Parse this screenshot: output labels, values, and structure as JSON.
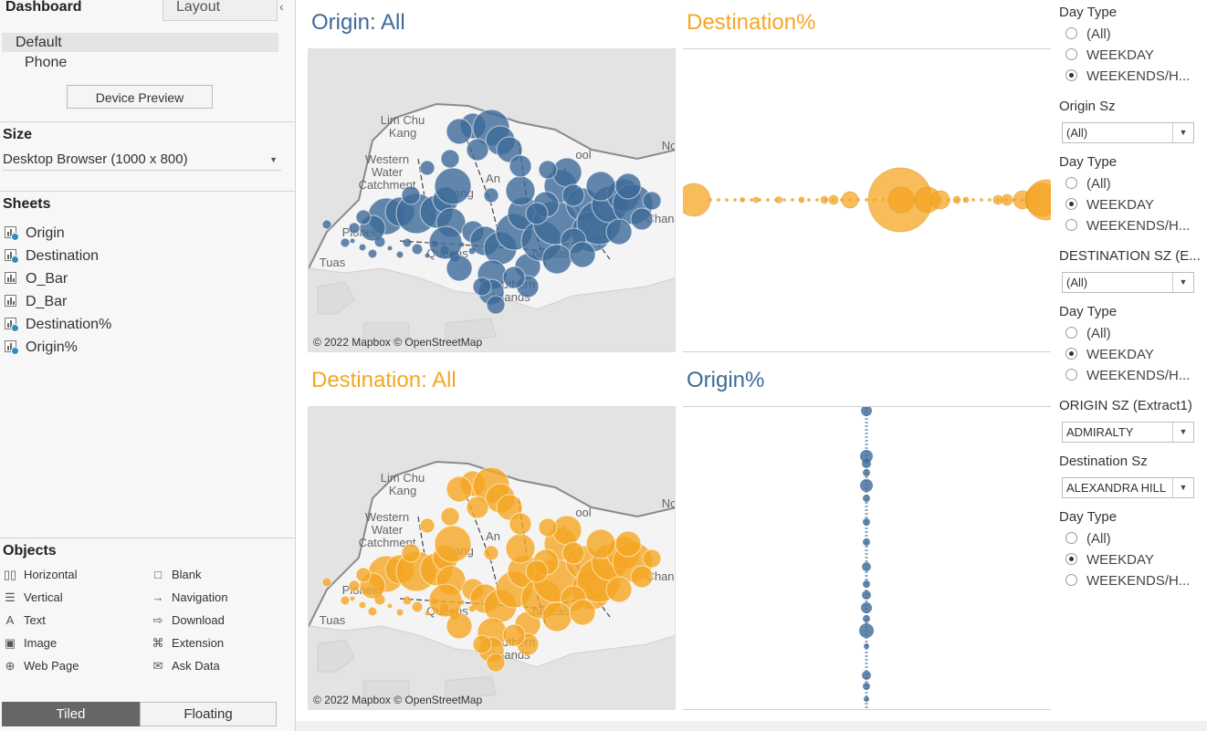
{
  "left_panel": {
    "tab_dashboard": "Dashboard",
    "tab_layout": "Layout",
    "collapse_icon": "chevron-left-icon",
    "device_default": "Default",
    "device_phone": "Phone",
    "device_preview_label": "Device Preview",
    "size_title": "Size",
    "size_value": "Desktop Browser (1000 x 800)",
    "sheets_title": "Sheets",
    "sheets": [
      {
        "label": "Origin",
        "in_use": true
      },
      {
        "label": "Destination",
        "in_use": true
      },
      {
        "label": "O_Bar",
        "in_use": false
      },
      {
        "label": "D_Bar",
        "in_use": false
      },
      {
        "label": "Destination%",
        "in_use": true
      },
      {
        "label": "Origin%",
        "in_use": true
      }
    ],
    "objects_title": "Objects",
    "objects": [
      {
        "label": "Horizontal",
        "icon": "horizontal-container-icon"
      },
      {
        "label": "Blank",
        "icon": "blank-icon"
      },
      {
        "label": "Vertical",
        "icon": "vertical-container-icon"
      },
      {
        "label": "Navigation",
        "icon": "navigation-icon"
      },
      {
        "label": "Text",
        "icon": "text-icon"
      },
      {
        "label": "Download",
        "icon": "download-icon"
      },
      {
        "label": "Image",
        "icon": "image-icon"
      },
      {
        "label": "Extension",
        "icon": "extension-icon"
      },
      {
        "label": "Web Page",
        "icon": "globe-icon"
      },
      {
        "label": "Ask Data",
        "icon": "ask-data-icon"
      }
    ],
    "tiled_label": "Tiled",
    "floating_label": "Floating"
  },
  "dashboard": {
    "origin_map_title": "Origin: All",
    "dest_pct_title": "Destination%",
    "dest_map_title": "Destination: All",
    "origin_pct_title": "Origin%",
    "map_credit": "© 2022 Mapbox © OpenStreetMap",
    "map_labels": {
      "lim_chu_kang": "Lim Chu\nKang",
      "western_water": "Western\nWater\nCatchment",
      "tuas": "Tuas",
      "pioneer": "Pioneer",
      "southern_islands": "Southern\nIslands",
      "queens": "Queens",
      "na_east": "na East",
      "chan": "Chan",
      "no": "No",
      "ool": "ool",
      "ang": "ang",
      "an": "An"
    },
    "colors": {
      "origin_blue": "#3d6a99",
      "destination_orange": "#f5a623"
    }
  },
  "filters": [
    {
      "type": "radio",
      "title": "Day Type",
      "options": [
        "(All)",
        "WEEKDAY",
        "WEEKENDS/H..."
      ],
      "selected": 2
    },
    {
      "type": "dropdown",
      "title": "Origin Sz",
      "value": "(All)"
    },
    {
      "type": "radio",
      "title": "Day Type",
      "options": [
        "(All)",
        "WEEKDAY",
        "WEEKENDS/H..."
      ],
      "selected": 1
    },
    {
      "type": "dropdown",
      "title": "DESTINATION SZ (E...",
      "value": "(All)"
    },
    {
      "type": "radio",
      "title": "Day Type",
      "options": [
        "(All)",
        "WEEKDAY",
        "WEEKENDS/H..."
      ],
      "selected": 1
    },
    {
      "type": "dropdown",
      "title": "ORIGIN SZ (Extract1)",
      "value": "ADMIRALTY"
    },
    {
      "type": "dropdown",
      "title": "Destination Sz",
      "value": "ALEXANDRA HILL"
    },
    {
      "type": "radio",
      "title": "Day Type",
      "options": [
        "(All)",
        "WEEKDAY",
        "WEEKENDS/H..."
      ],
      "selected": 1
    }
  ]
}
